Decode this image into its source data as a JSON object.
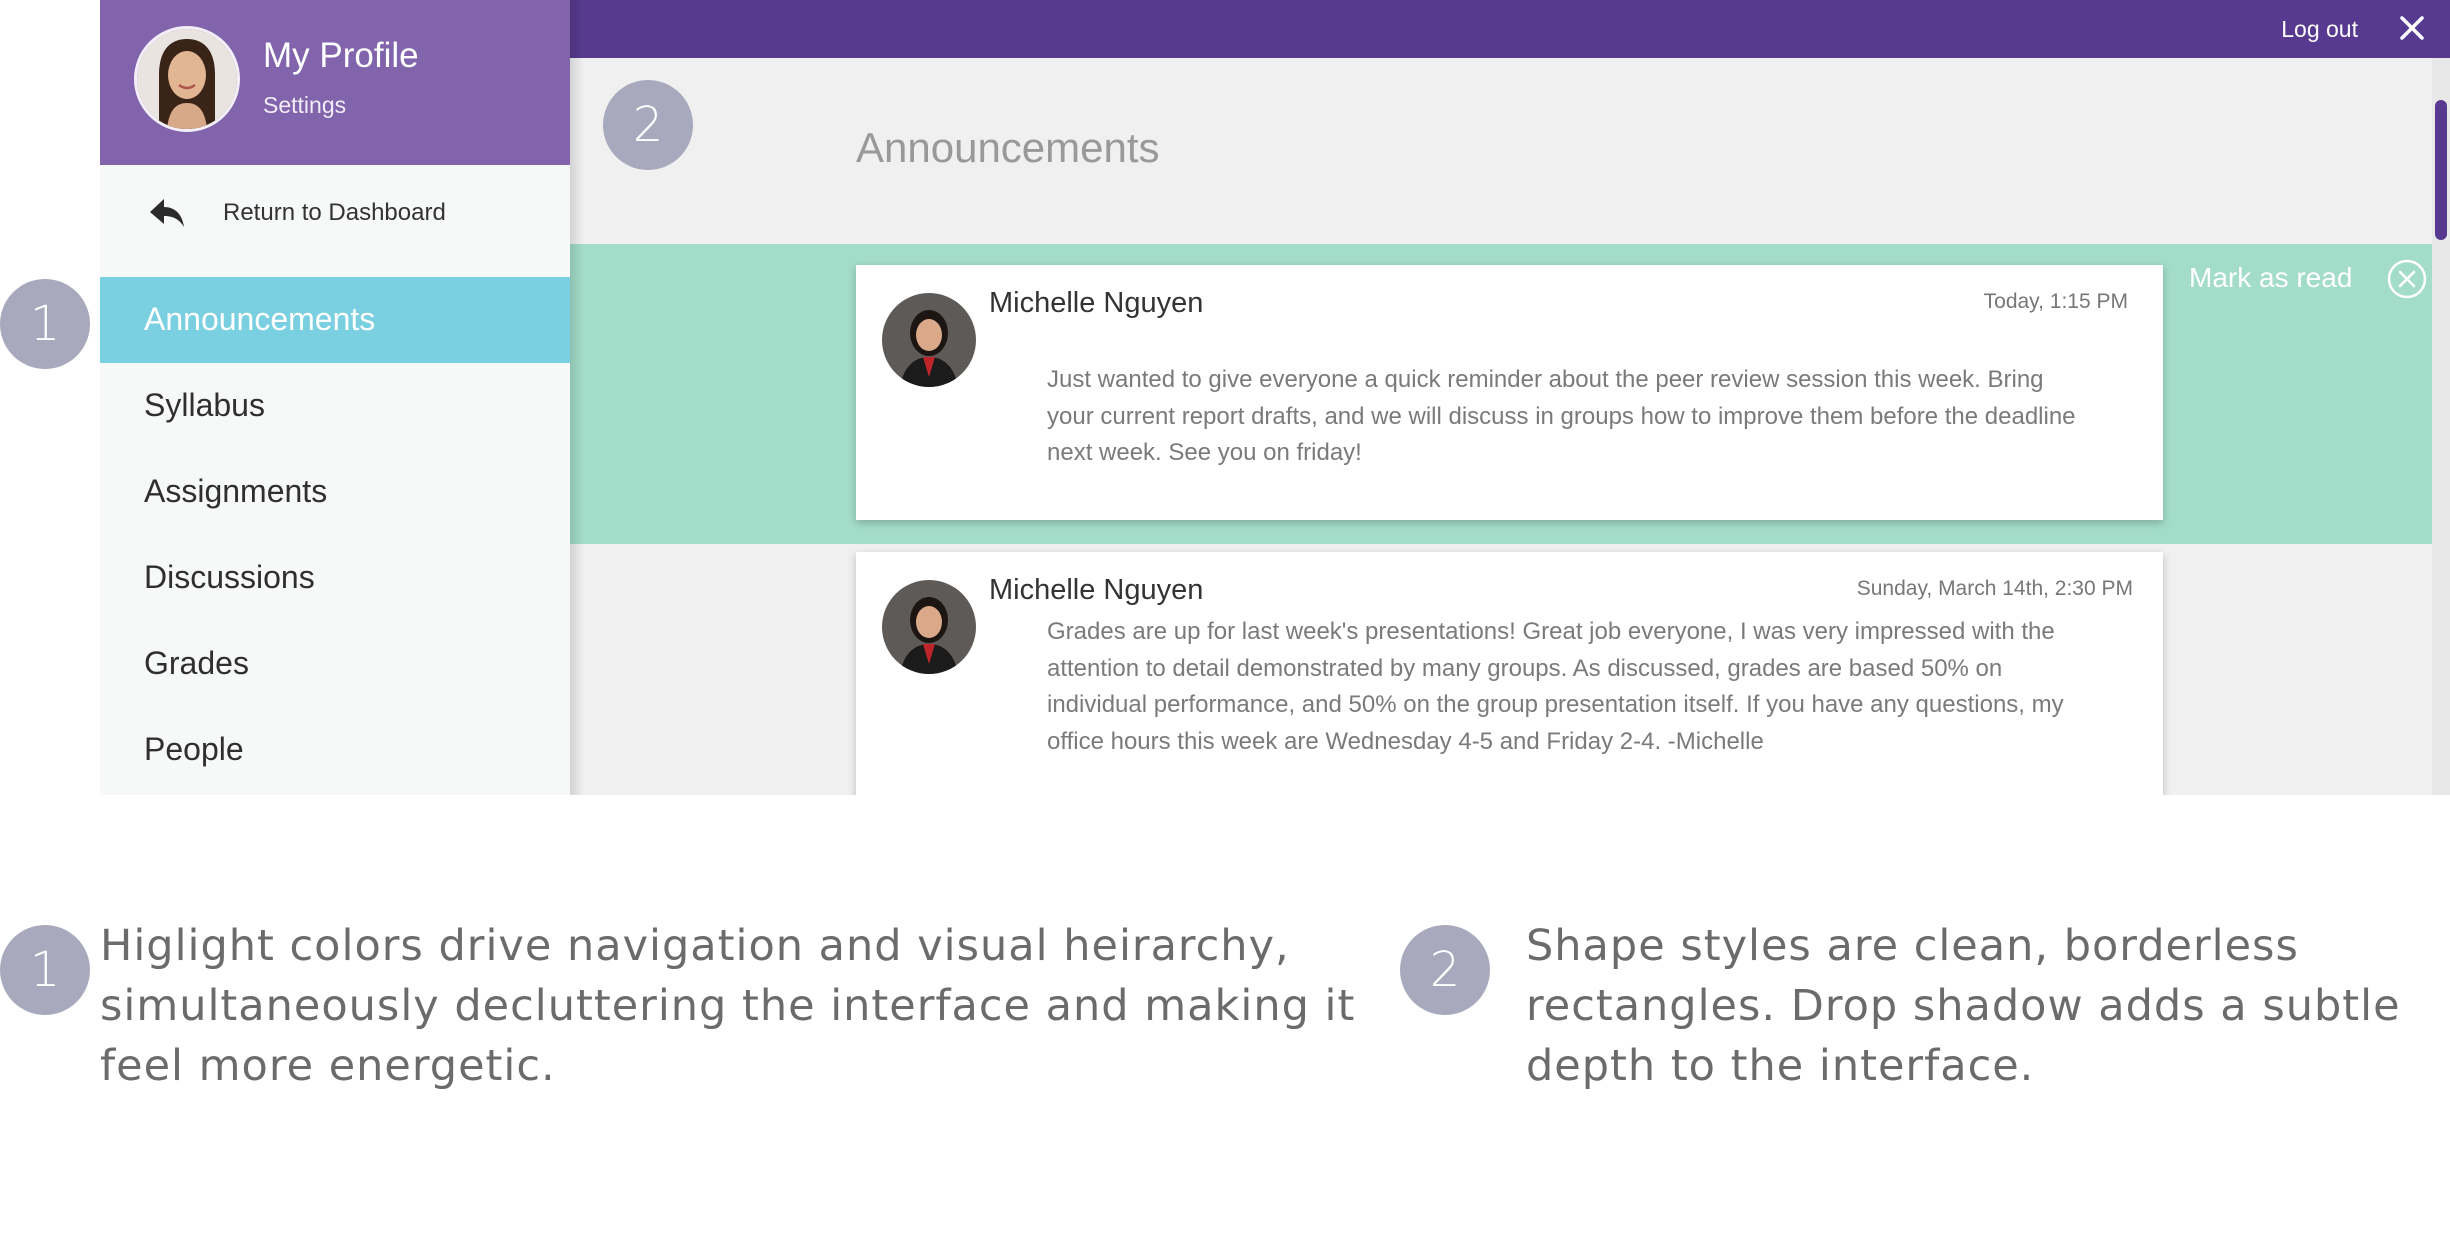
{
  "profile": {
    "name": "My Profile",
    "settings_label": "Settings"
  },
  "return_label": "Return to Dashboard",
  "nav": {
    "items": [
      {
        "label": "Announcements",
        "active": true
      },
      {
        "label": "Syllabus"
      },
      {
        "label": "Assignments"
      },
      {
        "label": "Discussions"
      },
      {
        "label": "Grades"
      },
      {
        "label": "People"
      }
    ]
  },
  "topbar": {
    "logout_label": "Log out"
  },
  "page": {
    "title": "Announcements"
  },
  "announcements": [
    {
      "author": "Michelle Nguyen",
      "time": "Today, 1:15 PM",
      "body": "Just wanted to give everyone a quick reminder about the peer review session this week. Bring your current report drafts, and we will discuss in groups how to improve them before the deadline next week. See you on friday!",
      "unread": true
    },
    {
      "author": "Michelle Nguyen",
      "time": "Sunday, March 14th, 2:30 PM",
      "body": "Grades are up for last week's presentations! Great job everyone, I was very impressed with the attention to detail demonstrated by many groups. As discussed, grades are based 50% on individual performance, and 50% on the group presentation itself. If you have any questions, my office hours this week are Wednesday 4-5 and Friday 2-4. -Michelle",
      "unread": false
    }
  ],
  "mark_read_label": "Mark as read",
  "colors": {
    "topbar": "#573a8f",
    "profile_header": "#8264ad",
    "active_nav": "#7ad0e0",
    "unread_highlight": "#a3dcc9",
    "step_badge": "#a9a9bd"
  },
  "icons": [
    "return-arrow-icon",
    "close-icon",
    "mark-read-close-icon"
  ],
  "markers": {
    "one": "1",
    "two": "2"
  },
  "notes": [
    {
      "number": "1",
      "text": "Higlight colors drive navigation and visual heirarchy, simultaneously decluttering the interface and making it feel more energetic."
    },
    {
      "number": "2",
      "text": "Shape styles are clean, borderless rectangles. Drop shadow adds a subtle depth to the interface."
    }
  ]
}
